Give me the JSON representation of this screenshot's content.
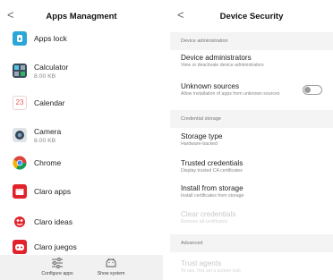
{
  "apps_screen": {
    "title": "Apps Managment",
    "back_glyph": "<",
    "apps": [
      {
        "name": "Apps lock",
        "size": "",
        "icon": "apps-lock-icon"
      },
      {
        "name": "Calculator",
        "size": "8.00 KB",
        "icon": "calculator-icon"
      },
      {
        "name": "Calendar",
        "size": "",
        "icon": "calendar-icon",
        "icon_text": "23"
      },
      {
        "name": "Camera",
        "size": "8.00 KB",
        "icon": "camera-icon"
      },
      {
        "name": "Chrome",
        "size": "",
        "icon": "chrome-icon"
      },
      {
        "name": "Claro apps",
        "size": "",
        "icon": "claro-apps-icon"
      },
      {
        "name": "Claro ideas",
        "size": "",
        "icon": "claro-ideas-icon"
      },
      {
        "name": "Claro juegos",
        "size": "",
        "icon": "claro-juegos-icon"
      }
    ],
    "bottom_bar": {
      "configure_label": "Configure apps",
      "show_system_label": "Show system"
    }
  },
  "security_screen": {
    "title": "Device Security",
    "back_glyph": "<",
    "sections": {
      "device_admin": "Device administration",
      "credential_storage": "Credential storage",
      "advanced": "Advanced"
    },
    "items": {
      "device_admins": {
        "title": "Device administrators",
        "subtitle": "View or deactivate device administrators"
      },
      "unknown_sources": {
        "title": "Unknown sources",
        "subtitle": "Allow installation of apps from unknown sources",
        "enabled": false
      },
      "storage_type": {
        "title": "Storage type",
        "subtitle": "Hardware-backed"
      },
      "trusted_credentials": {
        "title": "Trusted credentials",
        "subtitle": "Display trusted CA certificates"
      },
      "install_from_storage": {
        "title": "Install from storage",
        "subtitle": "Install certificates from storage"
      },
      "clear_credentials": {
        "title": "Clear credentials",
        "subtitle": "Remove all certificates"
      },
      "trust_agents": {
        "title": "Trust agents",
        "subtitle": "To use, first set a screen lock"
      }
    }
  },
  "colors": {
    "apps_lock": "#2aa7d8",
    "calculator": "#3a4b5a",
    "calendar": "#e85a5a",
    "camera": "#334455",
    "claro_red": "#e2222a",
    "section_bg": "#f4f4f4",
    "bottom_bar_bg": "#f1f1f1"
  }
}
